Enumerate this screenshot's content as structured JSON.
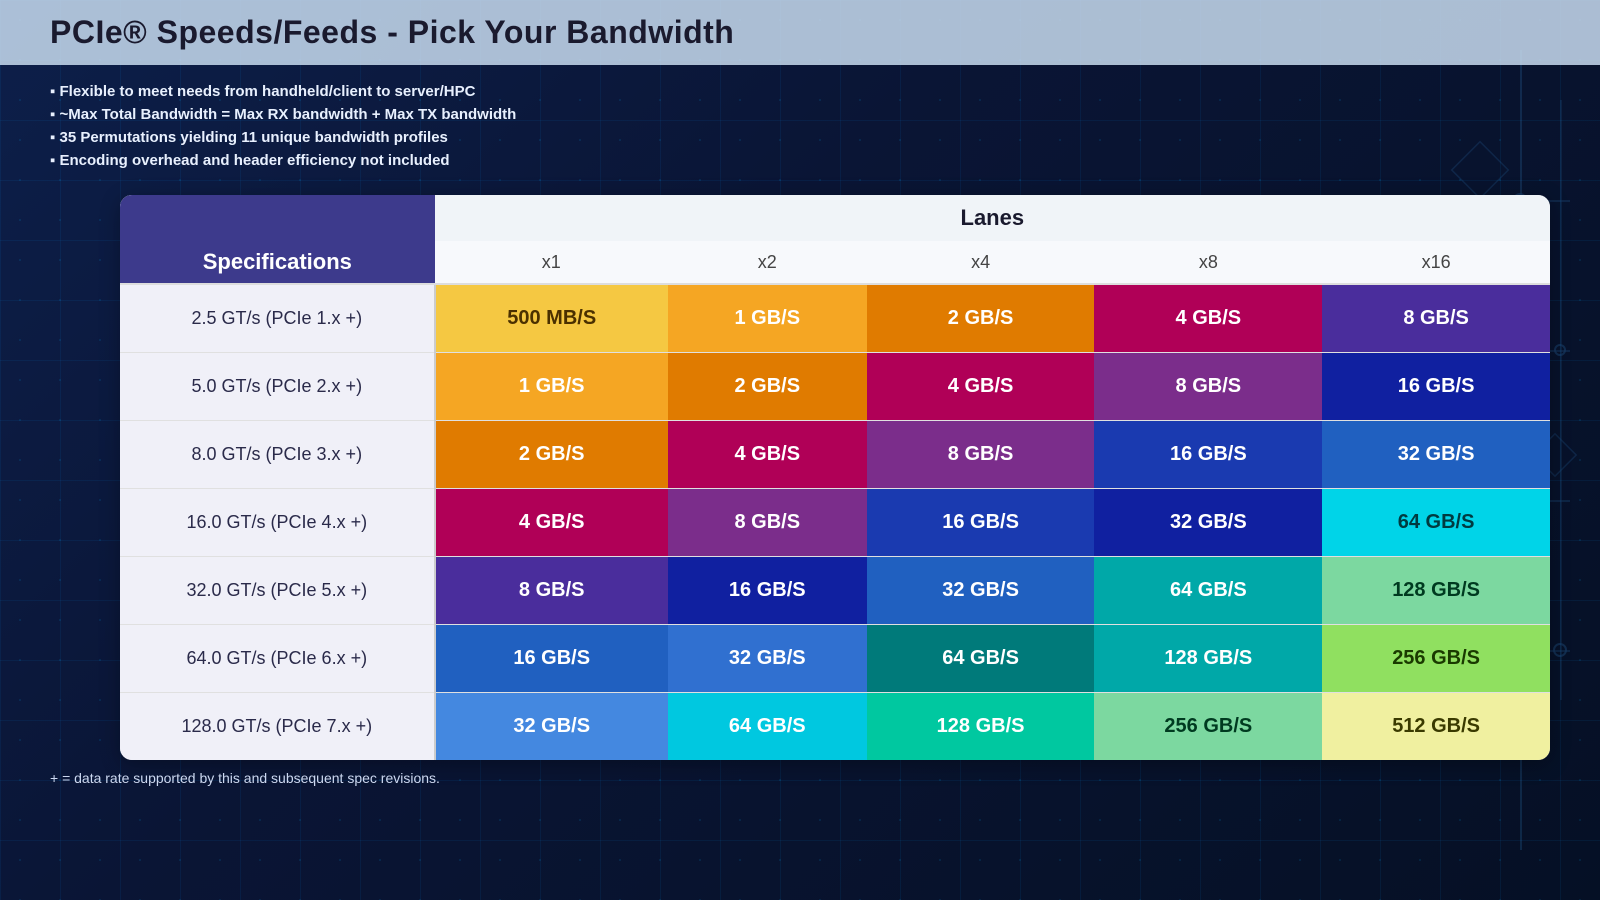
{
  "title": "PCIe® Speeds/Feeds - Pick Your Bandwidth",
  "bullets": [
    "Flexible to meet needs from handheld/client to server/HPC",
    "~Max Total Bandwidth = Max RX bandwidth + Max TX bandwidth",
    "35 Permutations yielding 11 unique bandwidth profiles",
    "Encoding overhead and header efficiency not included"
  ],
  "table": {
    "lanes_label": "Lanes",
    "spec_header": "Specifications",
    "lane_columns": [
      "x1",
      "x2",
      "x4",
      "x8",
      "x16"
    ],
    "rows": [
      {
        "spec": "2.5 GT/s (PCIe 1.x +)",
        "values": [
          "500 MB/S",
          "1 GB/S",
          "2 GB/S",
          "4 GB/S",
          "8 GB/S"
        ],
        "colors": [
          "cell-yellow",
          "cell-orange-light",
          "cell-orange",
          "cell-crimson",
          "cell-purple"
        ]
      },
      {
        "spec": "5.0 GT/s (PCIe 2.x +)",
        "values": [
          "1 GB/S",
          "2 GB/S",
          "4 GB/S",
          "8 GB/S",
          "16 GB/S"
        ],
        "colors": [
          "cell-orange-light",
          "cell-orange",
          "cell-crimson",
          "cell-purple-mid",
          "cell-blue-dark"
        ]
      },
      {
        "spec": "8.0 GT/s (PCIe 3.x +)",
        "values": [
          "2 GB/S",
          "4 GB/S",
          "8 GB/S",
          "16 GB/S",
          "32 GB/S"
        ],
        "colors": [
          "cell-orange",
          "cell-crimson",
          "cell-purple-mid",
          "cell-blue-royal",
          "cell-blue-medium"
        ]
      },
      {
        "spec": "16.0 GT/s (PCIe 4.x +)",
        "values": [
          "4 GB/S",
          "8 GB/S",
          "16 GB/S",
          "32 GB/S",
          "64 GB/S"
        ],
        "colors": [
          "cell-crimson",
          "cell-purple-mid",
          "cell-blue-royal",
          "cell-blue-dark",
          "cell-cyan-bright"
        ]
      },
      {
        "spec": "32.0 GT/s (PCIe 5.x +)",
        "values": [
          "8 GB/S",
          "16 GB/S",
          "32 GB/S",
          "64 GB/S",
          "128 GB/S"
        ],
        "colors": [
          "cell-purple",
          "cell-blue-dark",
          "cell-blue-medium",
          "cell-teal",
          "cell-green-light"
        ]
      },
      {
        "spec": "64.0 GT/s (PCIe 6.x +)",
        "values": [
          "16 GB/S",
          "32 GB/S",
          "64 GB/S",
          "128 GB/S",
          "256 GB/S"
        ],
        "colors": [
          "cell-blue-medium",
          "cell-blue-mid",
          "cell-teal-dark",
          "cell-teal",
          "cell-green-lime"
        ]
      },
      {
        "spec": "128.0 GT/s (PCIe 7.x +)",
        "values": [
          "32 GB/S",
          "64 GB/S",
          "128 GB/S",
          "256 GB/S",
          "512 GB/S"
        ],
        "colors": [
          "cell-blue-light",
          "cell-cyan",
          "cell-green-teal",
          "cell-green-light",
          "cell-yellow-light"
        ]
      }
    ]
  },
  "footnote": "+ = data rate supported by this and subsequent spec revisions."
}
